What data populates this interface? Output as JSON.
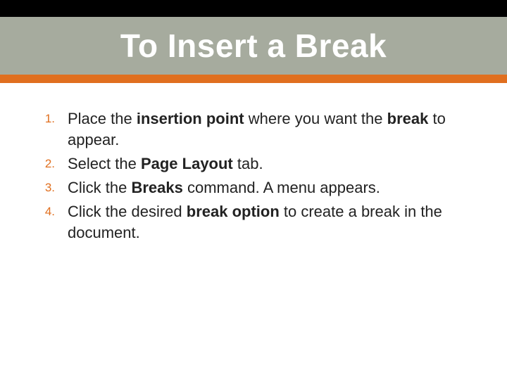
{
  "header": {
    "title": "To Insert a Break"
  },
  "steps": [
    {
      "num": "1.",
      "pre": "Place the ",
      "b1": "insertion point",
      "mid": " where you want the ",
      "b2": "break",
      "post": " to appear."
    },
    {
      "num": "2.",
      "pre": "Select the ",
      "b1": "Page Layout",
      "mid": " tab.",
      "b2": "",
      "post": ""
    },
    {
      "num": "3.",
      "pre": "Click the ",
      "b1": "Breaks",
      "mid": " command. A menu appears.",
      "b2": "",
      "post": ""
    },
    {
      "num": "4.",
      "pre": "Click the desired ",
      "b1": "break option",
      "mid": " to create a break in the document.",
      "b2": "",
      "post": ""
    }
  ]
}
